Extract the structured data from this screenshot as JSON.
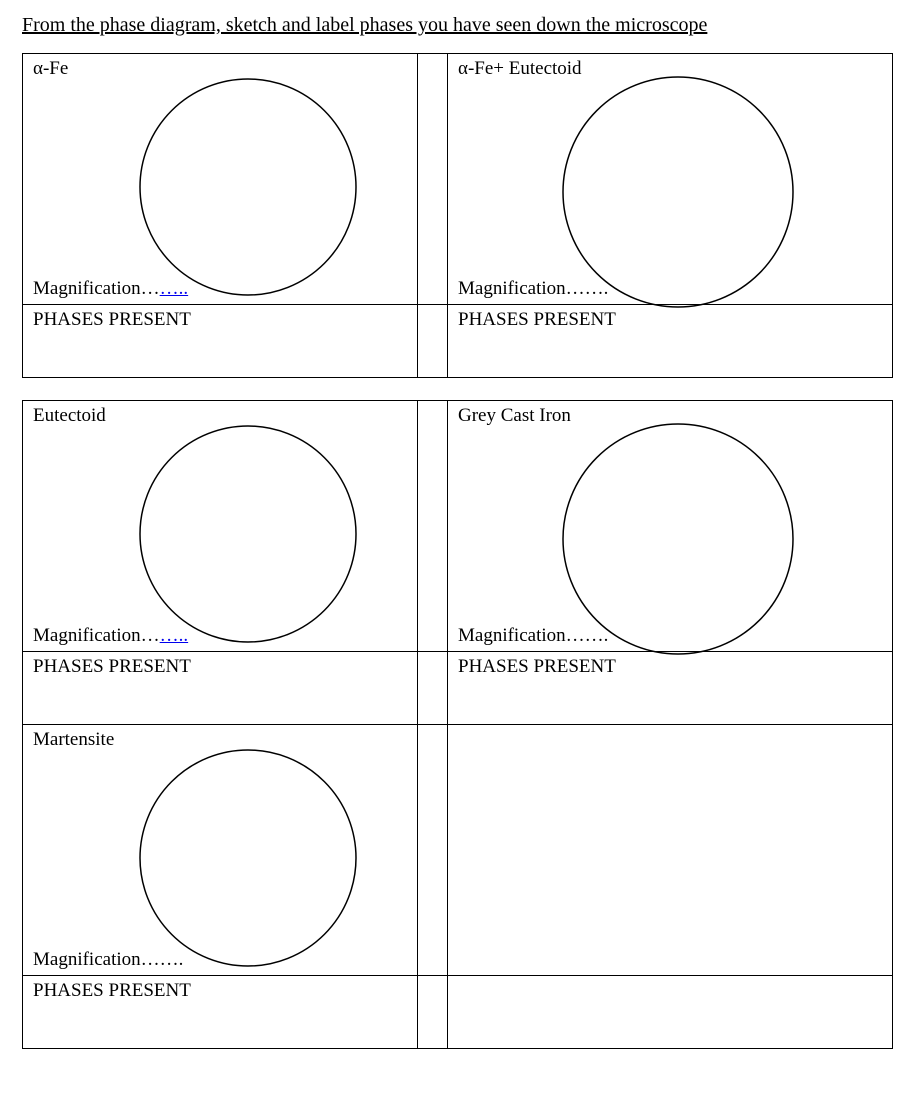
{
  "title": "From the phase diagram, sketch and label phases you have seen down the microscope",
  "labels": {
    "magnification": "Magnification…",
    "magDotsLink": "…..",
    "magDotsPlain": "….",
    "phasesPresent": "PHASES PRESENT"
  },
  "cells": {
    "r1c1": {
      "title": "α-Fe"
    },
    "r1c2": {
      "title": "α-Fe+ Eutectoid"
    },
    "r2c1": {
      "title": "Eutectoid"
    },
    "r2c2": {
      "title": "Grey Cast Iron"
    },
    "r3c1": {
      "title": "Martensite"
    },
    "r3c2": {
      "title": ""
    }
  }
}
